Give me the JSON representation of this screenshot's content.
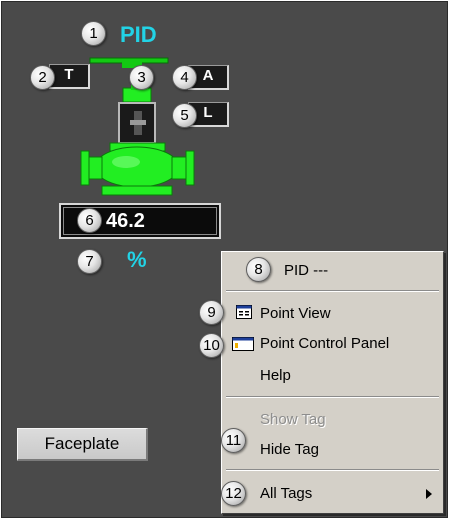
{
  "block": {
    "tag_label": "PID",
    "t_label": "T",
    "a_label": "A",
    "l_label": "L",
    "value": "46.2",
    "unit": "%",
    "faceplate_button": "Faceplate"
  },
  "callouts": [
    "1",
    "2",
    "3",
    "4",
    "5",
    "6",
    "7",
    "8",
    "9",
    "10",
    "11",
    "12"
  ],
  "context_menu": {
    "title": "PID ---",
    "point_view": "Point View",
    "point_control_panel": "Point Control Panel",
    "help": "Help",
    "show_tag": "Show Tag",
    "hide_tag": "Hide Tag",
    "all_tags": "All Tags"
  },
  "colors": {
    "background": "#4a4a4a",
    "accent_cyan": "#22d3e6",
    "valve_green": "#22ee22",
    "menu_bg": "#d4d0c8"
  },
  "icons": {
    "point_view": "point-view-icon",
    "point_control_panel": "point-control-panel-icon",
    "submenu": "chevron-right-icon"
  }
}
